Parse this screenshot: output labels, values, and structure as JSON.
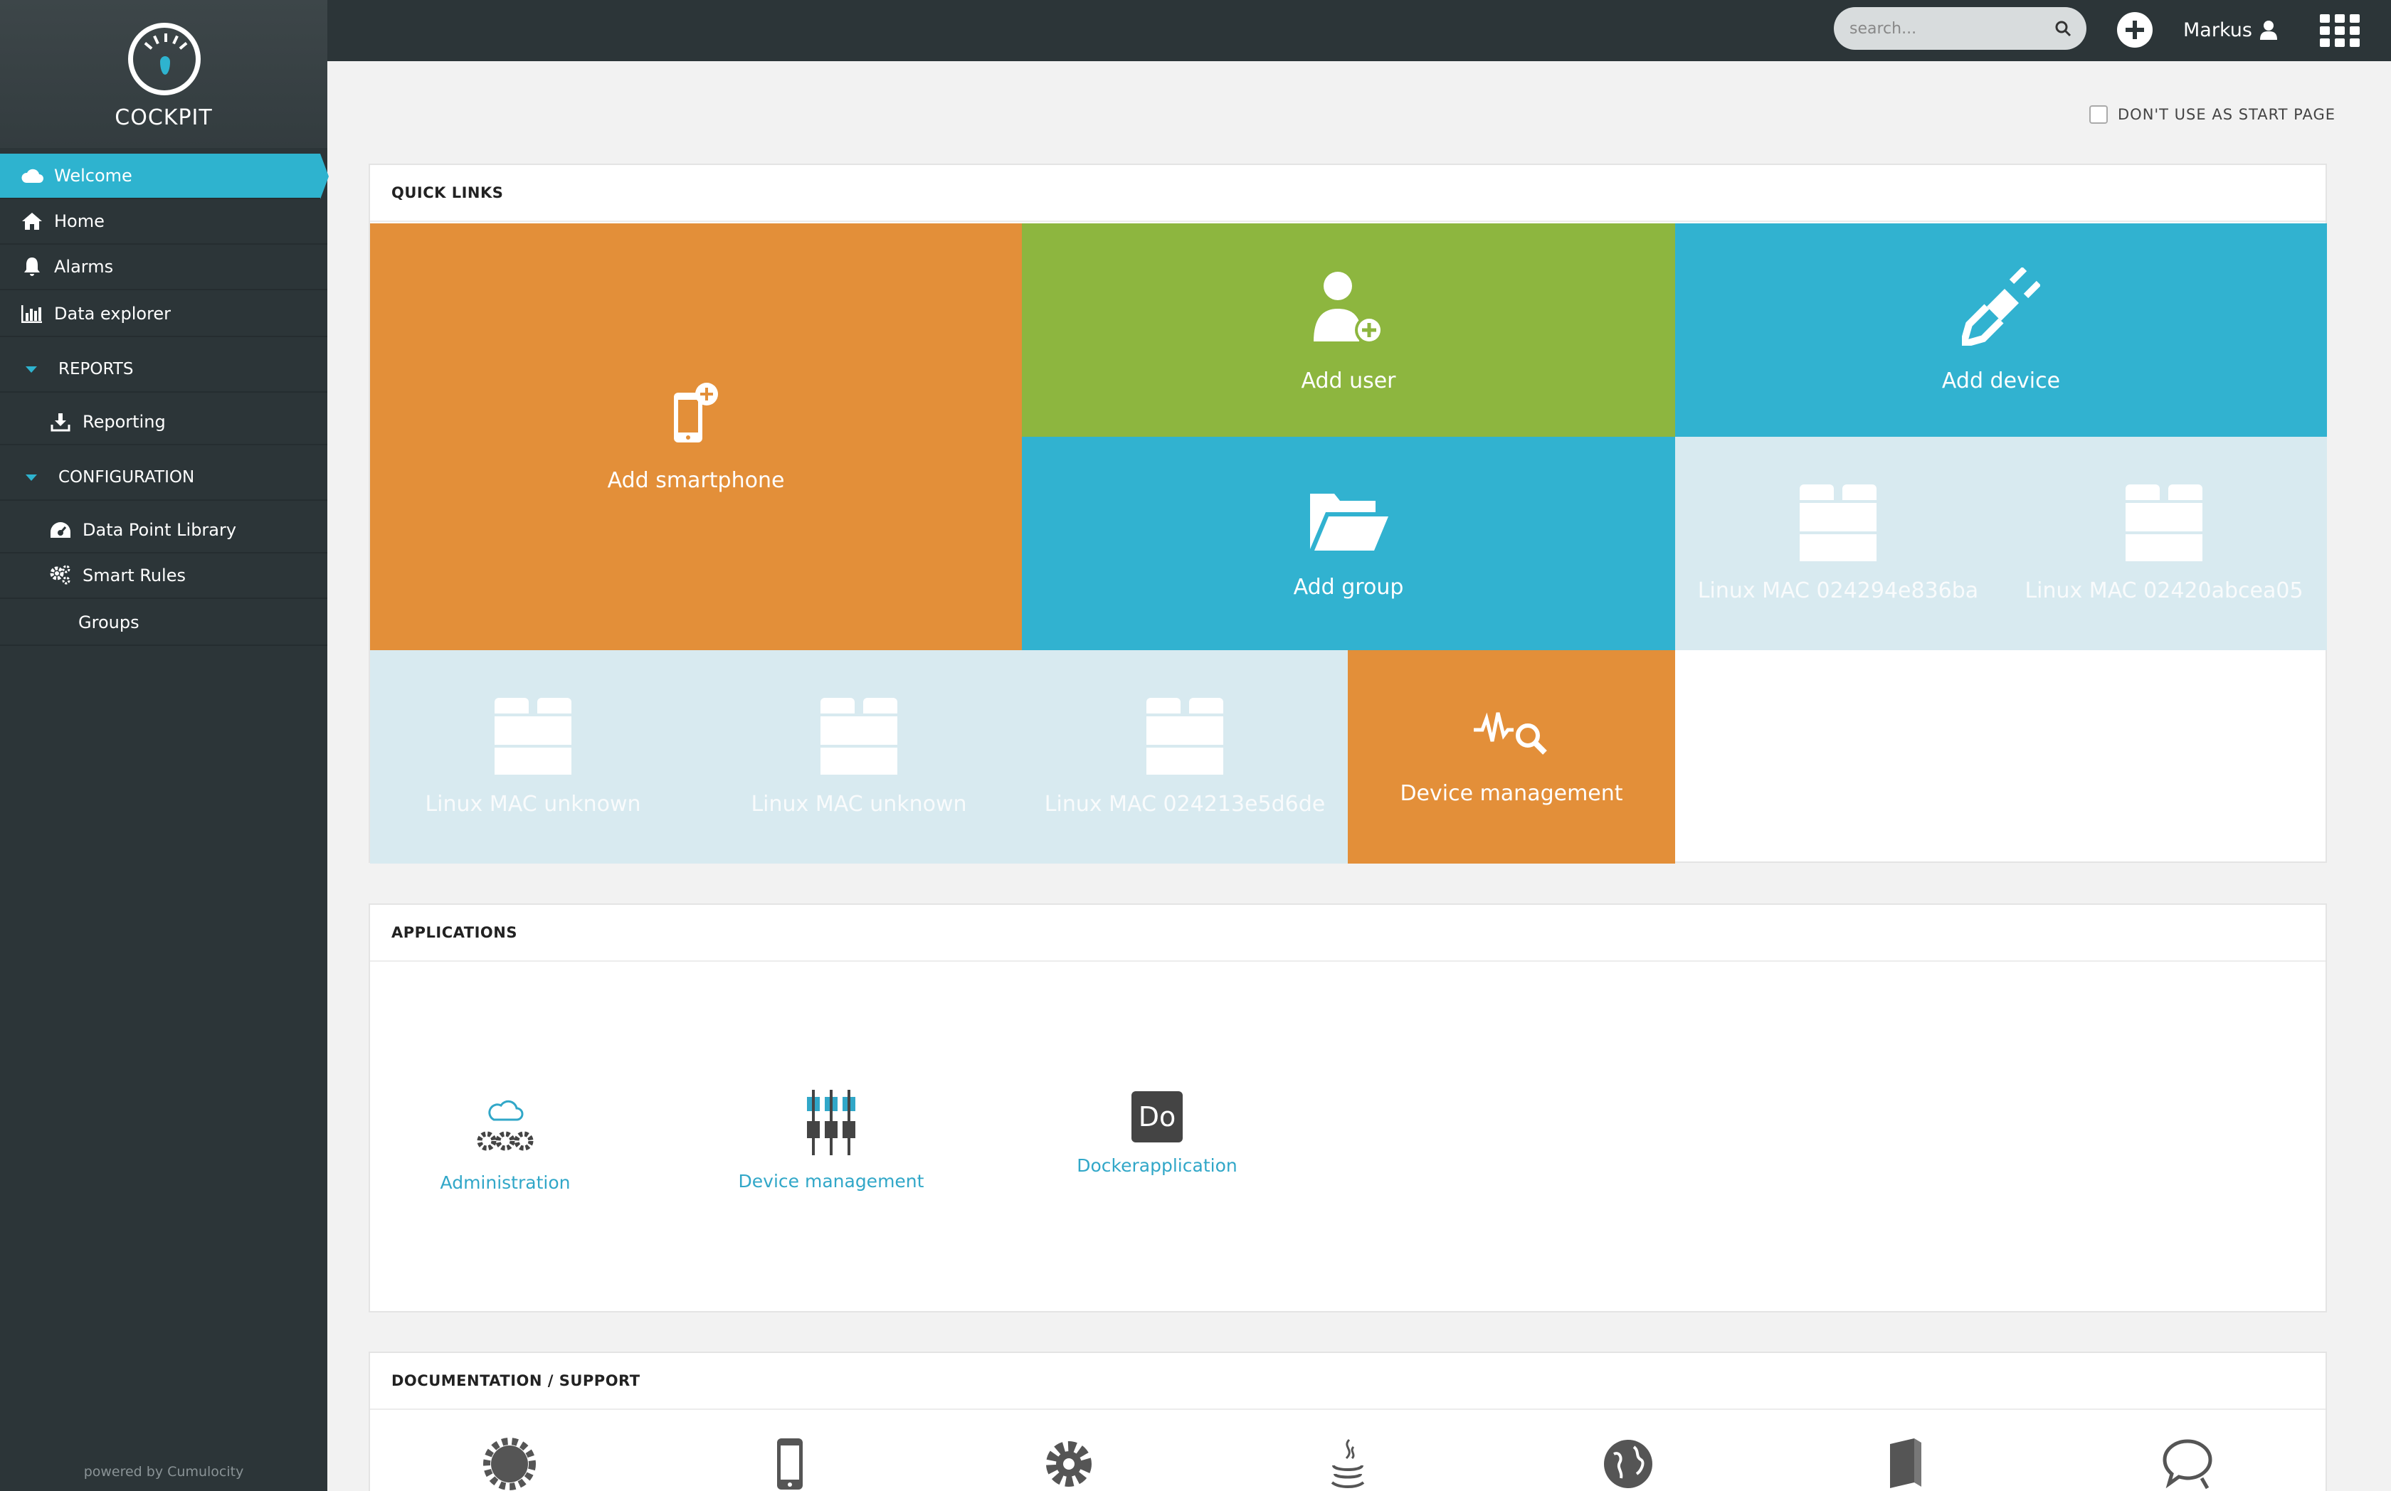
{
  "brand": {
    "name": "COCKPIT",
    "accent": "#2eb3cf",
    "sidebar_bg": "#2c3538"
  },
  "sidebar": {
    "items": [
      {
        "label": "Welcome",
        "icon": "cloud-icon",
        "active": true
      },
      {
        "label": "Home",
        "icon": "home-icon"
      },
      {
        "label": "Alarms",
        "icon": "bell-icon"
      },
      {
        "label": "Data explorer",
        "icon": "bar-chart-icon"
      }
    ],
    "groups": [
      {
        "label": "REPORTS",
        "items": [
          {
            "label": "Reporting",
            "icon": "download-icon"
          }
        ]
      },
      {
        "label": "CONFIGURATION",
        "items": [
          {
            "label": "Data Point Library",
            "icon": "dashboard-icon"
          },
          {
            "label": "Smart Rules",
            "icon": "gears-icon"
          },
          {
            "label": "Groups",
            "icon": ""
          }
        ]
      }
    ],
    "footer": "powered by Cumulocity"
  },
  "topbar": {
    "search_placeholder": "search...",
    "user_name": "Markus"
  },
  "start_page_option": "DON'T USE AS START PAGE",
  "quick_links": {
    "title": "QUICK LINKS",
    "tiles": [
      {
        "label": "Add smartphone",
        "color": "#e38f39",
        "icon": "smartphone-add-icon"
      },
      {
        "label": "Add user",
        "color": "#8db63f",
        "icon": "user-add-icon"
      },
      {
        "label": "Add device",
        "color": "#31b2d0",
        "icon": "plug-icon"
      },
      {
        "label": "Add group",
        "color": "#31b2d0",
        "icon": "folder-open-icon"
      },
      {
        "label": "Linux MAC 024294e836ba",
        "color": "#d8eaf0",
        "icon": "brick-icon"
      },
      {
        "label": "Linux MAC 02420abcea05",
        "color": "#d8eaf0",
        "icon": "brick-icon"
      },
      {
        "label": "Linux MAC unknown",
        "color": "#d8eaf0",
        "icon": "brick-icon"
      },
      {
        "label": "Linux MAC unknown",
        "color": "#d8eaf0",
        "icon": "brick-icon"
      },
      {
        "label": "Linux MAC 024213e5d6de",
        "color": "#d8eaf0",
        "icon": "brick-icon"
      },
      {
        "label": "Device management",
        "color": "#e38f39",
        "icon": "pulse-search-icon"
      }
    ]
  },
  "applications": {
    "title": "APPLICATIONS",
    "items": [
      {
        "label": "Administration",
        "icon": "cloud-gears-icon"
      },
      {
        "label": "Device management",
        "icon": "sliders-icon"
      },
      {
        "label": "Dockerapplication",
        "icon": "do-badge-icon",
        "badge": "Do"
      }
    ]
  },
  "documentation": {
    "title": "DOCUMENTATION / SUPPORT",
    "icons": [
      "badge-gear-icon",
      "mobile-icon",
      "gear-icon",
      "java-icon",
      "globe-icon",
      "book-icon",
      "chat-icon"
    ]
  }
}
